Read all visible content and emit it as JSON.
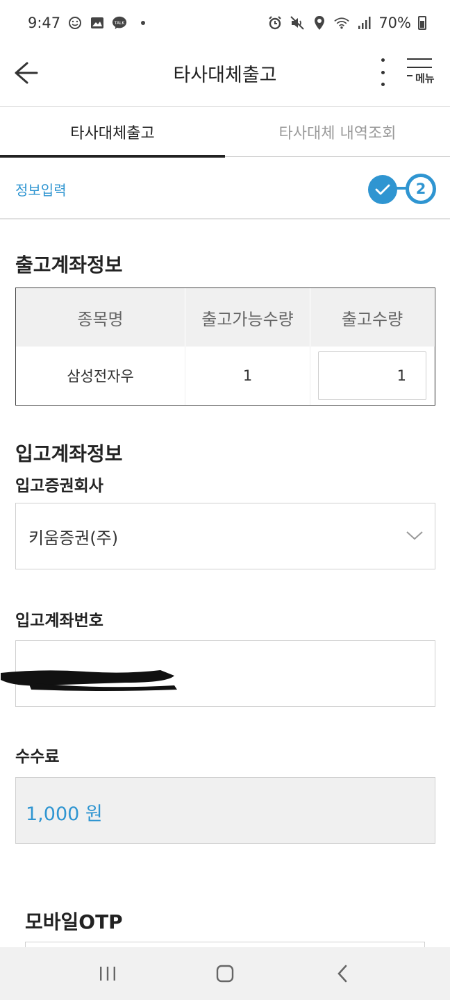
{
  "status_bar": {
    "time": "9:47",
    "battery": "70%",
    "notification_icons": [
      "smile-icon",
      "image-icon",
      "talk-icon",
      "dot-icon"
    ],
    "system_icons": [
      "alarm-icon",
      "mute-icon",
      "location-icon",
      "wifi-icon",
      "signal-icon",
      "battery-icon"
    ],
    "talk_badge": "TALK"
  },
  "header": {
    "title": "타사대체출고",
    "menu_label": "메뉴"
  },
  "tabs": [
    {
      "label": "타사대체출고",
      "active": true
    },
    {
      "label": "타사대체 내역조회",
      "active": false
    }
  ],
  "step": {
    "label": "정보입력",
    "current_step": "2"
  },
  "withdraw_section": {
    "title": "출고계좌정보",
    "columns": [
      "종목명",
      "출고가능수량",
      "출고수량"
    ],
    "row": {
      "name": "삼성전자우",
      "available": "1",
      "quantity": "1"
    }
  },
  "deposit_section": {
    "title": "입고계좌정보",
    "broker_label": "입고증권회사",
    "broker_value": "키움증권(주)",
    "account_label": "입고계좌번호"
  },
  "fee": {
    "label": "수수료",
    "value": "1,000 원"
  },
  "otp": {
    "title": "모바일OTP"
  },
  "colors": {
    "accent": "#2f95d1",
    "fee_background": "#f0f0f0",
    "table_header_bg": "#f0f0f0"
  }
}
